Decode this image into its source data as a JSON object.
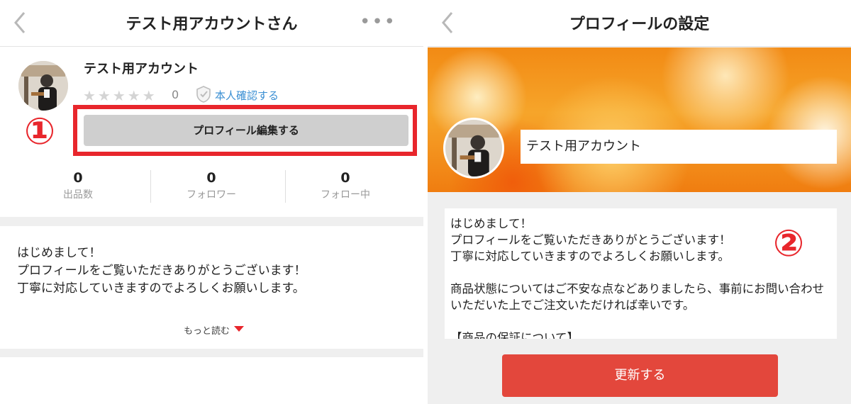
{
  "left": {
    "header": {
      "title": "テスト用アカウントさん",
      "more": "•••"
    },
    "profile": {
      "username": "テスト用アカウント",
      "stars": "★★★★★",
      "rating_count": "0",
      "verify_label": "本人確認する"
    },
    "callout_number": "①",
    "edit_button": "プロフィール編集する",
    "stats": [
      {
        "value": "0",
        "label": "出品数"
      },
      {
        "value": "0",
        "label": "フォロワー"
      },
      {
        "value": "0",
        "label": "フォロー中"
      }
    ],
    "bio": "はじめまして！\nプロフィールをご覧いただきありがとうございます！\n丁寧に対応していきますのでよろしくお願いします。",
    "read_more": "もっと読む"
  },
  "right": {
    "header": {
      "title": "プロフィールの設定"
    },
    "name_value": "テスト用アカウント",
    "bio": "はじめまして！\nプロフィールをご覧いただきありがとうございます！\n丁寧に対応していきますのでよろしくお願いします。\n\n商品状態についてはご不安な点などありましたら、事前にお問い合わせいただいた上でご注文いただければ幸いです。\n\n【商品の保証について】",
    "callout_number": "②",
    "update_button": "更新する"
  },
  "colors": {
    "accent_red": "#e8262c",
    "button_red": "#e3473c",
    "link_blue": "#3a8fd3",
    "banner_orange": "#f28a14"
  },
  "icons": [
    "back-chevron-icon",
    "more-dots-icon",
    "star-icon",
    "verified-shield-icon",
    "caret-down-icon"
  ]
}
